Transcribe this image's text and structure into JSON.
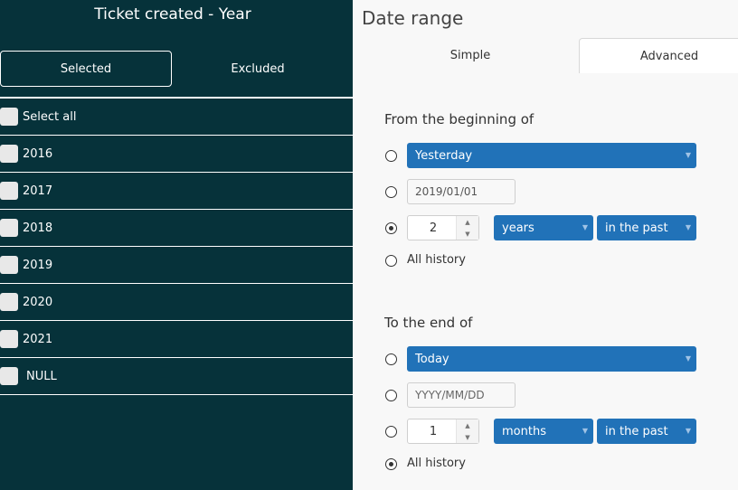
{
  "filter": {
    "title": "Ticket created - Year",
    "segments": {
      "selected": "Selected",
      "excluded": "Excluded"
    },
    "select_all": "Select all",
    "items": [
      "2016",
      "2017",
      "2018",
      "2019",
      "2020",
      "2021",
      "NULL"
    ]
  },
  "date_range": {
    "title": "Date range",
    "tabs": {
      "simple": "Simple",
      "advanced": "Advanced"
    },
    "from": {
      "label": "From the beginning of",
      "relative_day": "Yesterday",
      "date_value": "2019/01/01",
      "amount": "2",
      "unit": "years",
      "direction": "in the past",
      "all_history": "All history",
      "selected_option": "amount"
    },
    "to": {
      "label": "To the end of",
      "relative_day": "Today",
      "date_placeholder": "YYYY/MM/DD",
      "amount": "1",
      "unit": "months",
      "direction": "in the past",
      "all_history": "All history",
      "selected_option": "all_history"
    }
  },
  "colors": {
    "panel_dark": "#06323a",
    "accent_blue": "#2172b8",
    "panel_light": "#f8f8f8"
  }
}
